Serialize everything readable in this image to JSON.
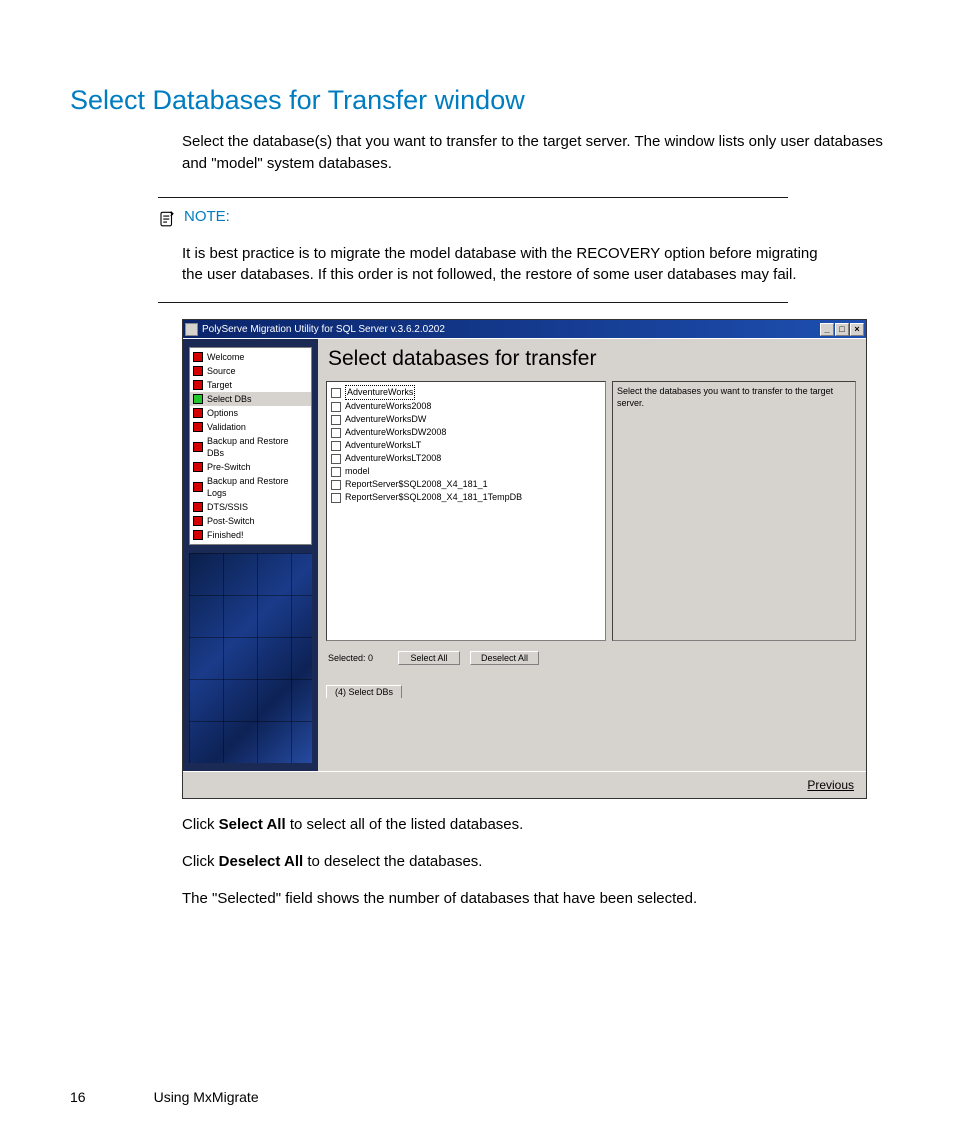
{
  "doc": {
    "heading": "Select Databases for Transfer window",
    "intro": "Select the database(s) that you want to transfer to the target server. The window lists only user databases and \"model\" system databases.",
    "note_label": "NOTE:",
    "note_text": "It is best practice is to migrate the model database with the RECOVERY option before migrating the user databases. If this order is not followed, the restore of some user databases may fail.",
    "p_select_all_pre": "Click ",
    "p_select_all_bold": "Select All",
    "p_select_all_post": " to select all of the listed databases.",
    "p_deselect_all_pre": "Click ",
    "p_deselect_all_bold": "Deselect All",
    "p_deselect_all_post": " to deselect the databases.",
    "p_selected_field": "The \"Selected\" field shows the number of databases that have been selected.",
    "page_number": "16",
    "footer_chapter": "Using MxMigrate"
  },
  "app": {
    "title": "PolyServe Migration Utility for SQL Server v.3.6.2.0202",
    "heading": "Select databases for transfer",
    "sidebar_steps": [
      {
        "label": "Welcome",
        "color": "red",
        "active": false
      },
      {
        "label": "Source",
        "color": "red",
        "active": false
      },
      {
        "label": "Target",
        "color": "red",
        "active": false
      },
      {
        "label": "Select DBs",
        "color": "green",
        "active": true
      },
      {
        "label": "Options",
        "color": "red",
        "active": false
      },
      {
        "label": "Validation",
        "color": "red",
        "active": false
      },
      {
        "label": "Backup and Restore DBs",
        "color": "red",
        "active": false
      },
      {
        "label": "Pre-Switch",
        "color": "red",
        "active": false
      },
      {
        "label": "Backup and Restore Logs",
        "color": "red",
        "active": false
      },
      {
        "label": "DTS/SSIS",
        "color": "red",
        "active": false
      },
      {
        "label": "Post-Switch",
        "color": "red",
        "active": false
      },
      {
        "label": "Finished!",
        "color": "red",
        "active": false
      }
    ],
    "databases": [
      "AdventureWorks",
      "AdventureWorks2008",
      "AdventureWorksDW",
      "AdventureWorksDW2008",
      "AdventureWorksLT",
      "AdventureWorksLT2008",
      "model",
      "ReportServer$SQL2008_X4_181_1",
      "ReportServer$SQL2008_X4_181_1TempDB"
    ],
    "info_text": "Select the databases you want to transfer to the target server.",
    "selected_label": "Selected: 0",
    "select_all": "Select All",
    "deselect_all": "Deselect All",
    "tab_label": "(4) Select DBs",
    "previous": "Previous"
  }
}
